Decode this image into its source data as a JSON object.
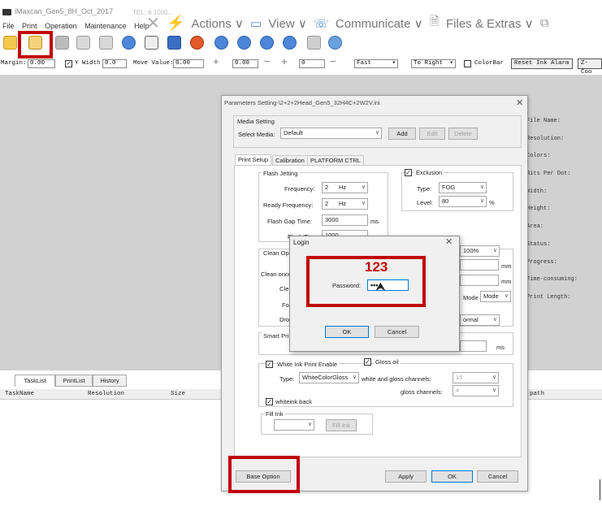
{
  "app": {
    "title": "iMaxcan_Gen5_8H_Oct_2017",
    "subtitle": "TEL: 6 1000..."
  },
  "menu": [
    "File",
    "Print",
    "Operation",
    "Maintenance",
    "Help"
  ],
  "ribbon": [
    {
      "label": "Actions ∨",
      "icon": "actions-icon"
    },
    {
      "label": "View ∨",
      "icon": "view-icon"
    },
    {
      "label": "Communicate ∨",
      "icon": "communicate-icon"
    },
    {
      "label": "Files & Extras ∨",
      "icon": "files-extras-icon"
    }
  ],
  "settings_bar": {
    "margin_label": "Margin:",
    "margin_value": "0.00",
    "ywidth_label": "Y Width",
    "ywidth_value": "0.0",
    "move_label": "Move Value:",
    "move_value": "0.00",
    "value1": "0.00",
    "value2": "0",
    "speed": "Fast",
    "direction": "To Right",
    "colorbar_label": "ColorBar",
    "reset_button": "Reset Ink Alarm",
    "zcoord_button": "Z-Coo"
  },
  "right_panel": [
    "File Name:",
    "Resolution:",
    "Colors:",
    "Bits Per Dot:",
    "Width:",
    "Height:",
    "Area:",
    "Status:",
    "Progress:",
    "Time-consuming:",
    "Print Length:"
  ],
  "task_tabs": [
    "TaskList",
    "PrintList",
    "History"
  ],
  "task_columns": [
    "TaskName",
    "Resolution",
    "Size",
    "path"
  ],
  "param_dialog": {
    "title": "Parameters Setting-\\2+2+2Head_Gen5_32H4C+2W2V.ini",
    "media_setting_label": "Media Setting",
    "select_media_label": "Select Media:",
    "select_media_value": "Default",
    "add_button": "Add",
    "edit_button": "Edit",
    "delete_button": "Delete",
    "tabs": [
      "Print Setup",
      "Calibration",
      "PLATFORM CTRL"
    ],
    "flash_jetting": {
      "title": "Flash Jetting",
      "frequency_label": "Frequency:",
      "frequency_value": "2",
      "ready_frequency_label": "Ready Frequency:",
      "ready_frequency_value": "2",
      "unit_hz": "Hz",
      "gap_time_label": "Flash Gap Time:",
      "gap_time_value": "3000",
      "unit_ms": "ms",
      "flash_time_label": "Flash Time:",
      "flash_time_value": "1000"
    },
    "exclusion": {
      "label": "Exclusion",
      "type_label": "Type:",
      "type_value": "FOG",
      "level_label": "Level:",
      "level_value": "80",
      "unit": "%"
    },
    "clean_partial": {
      "title": "Clean Op",
      "line1": "Clean once",
      "line2": "Cle",
      "line3": "Fo",
      "line4": "Dro",
      "pct_value": "100%",
      "unit_mm": "mm",
      "mode_label": "Mode",
      "mode_value": "Mode",
      "normal_value": "ormal"
    },
    "smart_print": {
      "label": "Smart Pri",
      "unit_ms": "ms"
    },
    "white_ink": {
      "enable_label": "White Ink Print Enable",
      "gloss_label": "Gloss oil",
      "type_label": "Type:",
      "type_value": "WhiteColorGloss",
      "white_gloss_channels_label": "white and gloss channels:",
      "white_gloss_channels_value": "15",
      "gloss_channels_label": "gloss channels:",
      "gloss_channels_value": "4",
      "whiteink_back_label": "whiteink back"
    },
    "fill_ink": {
      "title": "Fill Ink",
      "button": "Fill Ink"
    },
    "base_option_button": "Base Option",
    "apply_button": "Apply",
    "ok_button": "OK",
    "cancel_button": "Cancel"
  },
  "login_dialog": {
    "title": "Login",
    "password_label": "Password:",
    "password_value": "•••",
    "ok_button": "OK",
    "cancel_button": "Cancel"
  },
  "annotation": {
    "text": "123",
    "color": "#c00000"
  }
}
